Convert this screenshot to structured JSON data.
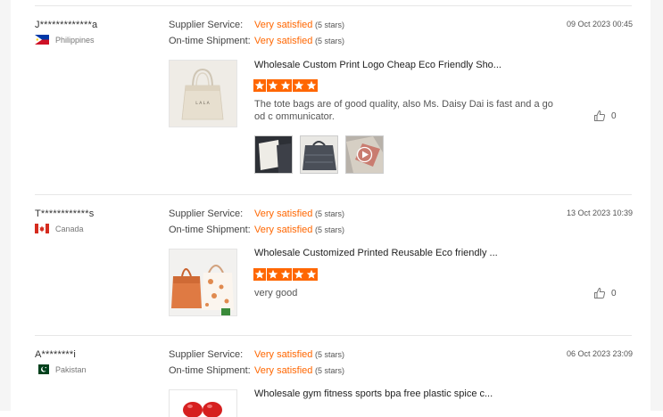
{
  "labels": {
    "supplier_service": "Supplier Service:",
    "on_time_shipment": "On-time Shipment:"
  },
  "reviews": [
    {
      "reviewer": "J*************a",
      "country": "Philippines",
      "supplier_rating": "Very satisfied",
      "supplier_stars": "(5 stars)",
      "shipment_rating": "Very satisfied",
      "shipment_stars": "(5 stars)",
      "date": "09 Oct 2023 00:45",
      "product_title": "Wholesale Custom Print Logo Cheap Eco Friendly Sho...",
      "stars": 5,
      "comment": "The tote bags are of good quality, also Ms. Daisy Dai is fast and a good c ommunicator.",
      "likes": "0",
      "image_text": "L A L A",
      "thumbnails": [
        "photo",
        "photo",
        "video"
      ]
    },
    {
      "reviewer": "T************s",
      "country": "Canada",
      "supplier_rating": "Very satisfied",
      "supplier_stars": "(5 stars)",
      "shipment_rating": "Very satisfied",
      "shipment_stars": "(5 stars)",
      "date": "13 Oct 2023 10:39",
      "product_title": "Wholesale Customized Printed Reusable Eco friendly ...",
      "stars": 5,
      "comment": "very good",
      "likes": "0"
    },
    {
      "reviewer": "A********i",
      "country": "Pakistan",
      "supplier_rating": "Very satisfied",
      "supplier_stars": "(5 stars)",
      "shipment_rating": "Very satisfied",
      "shipment_stars": "(5 stars)",
      "date": "06 Oct 2023 23:09",
      "product_title": "Wholesale gym fitness sports bpa free plastic spice c..."
    }
  ],
  "icons": {
    "star": "star-icon",
    "like": "thumbs-up-icon",
    "play": "play-icon"
  },
  "colors": {
    "accent": "#ff6600",
    "divider": "#e6e6e6"
  }
}
